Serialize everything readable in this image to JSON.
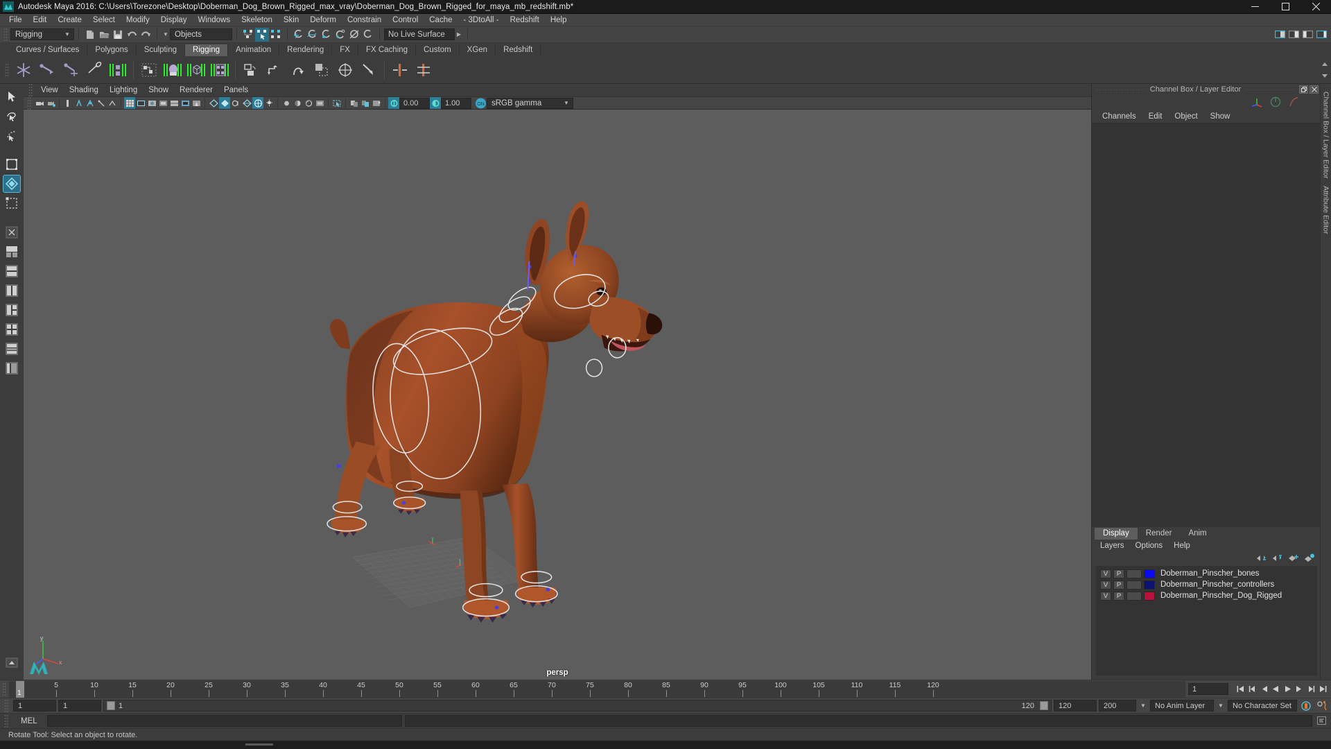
{
  "window": {
    "title": "Autodesk Maya 2016: C:\\Users\\Torezone\\Desktop\\Doberman_Dog_Brown_Rigged_max_vray\\Doberman_Dog_Brown_Rigged_for_maya_mb_redshift.mb*",
    "minimize": "minimize-icon",
    "maximize": "maximize-icon",
    "close": "close-icon"
  },
  "menubar": {
    "items": [
      "File",
      "Edit",
      "Create",
      "Select",
      "Modify",
      "Display",
      "Windows",
      "Skeleton",
      "Skin",
      "Deform",
      "Constrain",
      "Control",
      "Cache",
      "- 3DtoAll -",
      "Redshift",
      "Help"
    ]
  },
  "statusline": {
    "menuset": "Rigging",
    "selection_mask": "Objects",
    "live_surface": "No Live Surface",
    "icons": [
      "new-scene-icon",
      "open-scene-icon",
      "save-scene-icon",
      "undo-icon",
      "redo-icon",
      "select-hierarchy-icon",
      "select-object-icon",
      "select-component-icon",
      "snap-grid-icon",
      "snap-curve-icon",
      "snap-point-icon",
      "snap-projected-icon",
      "snap-view-plane-icon",
      "make-live-icon",
      "show-hide-editors-icon",
      "attribute-editor-icon",
      "tool-settings-icon",
      "channel-box-icon"
    ]
  },
  "shelf": {
    "tabs": [
      "Curves / Surfaces",
      "Polygons",
      "Sculpting",
      "Rigging",
      "Animation",
      "Rendering",
      "FX",
      "FX Caching",
      "Custom",
      "XGen",
      "Redshift"
    ],
    "active_tab": "Rigging",
    "icons": [
      "create-joint-icon",
      "create-ik-handle-icon",
      "create-ik-spline-handle-icon",
      "insert-joint-icon",
      "bind-skin-icon",
      "interactive-bind-icon",
      "paint-skin-weights-icon",
      "smooth-bind-icon",
      "mirror-skin-weights-icon",
      "parent-constraint-icon",
      "point-constraint-icon",
      "orient-constraint-icon",
      "scale-constraint-icon",
      "aim-constraint-icon",
      "pole-vector-constraint-icon",
      "create-deformer-icon",
      "lattice-deformer-icon"
    ]
  },
  "toolbox": {
    "items": [
      "select-tool",
      "lasso-select-tool",
      "paint-select-tool",
      "move-tool",
      "rotate-tool",
      "scale-tool",
      "last-tool",
      "layout-single-icon",
      "layout-two-panes-side-icon",
      "layout-two-panes-stacked-icon",
      "layout-three-panes-icon",
      "layout-four-panes-icon",
      "layout-persp-outliner-icon",
      "layout-hypergraph-icon",
      "layout-more-icon"
    ],
    "selected": "rotate-tool"
  },
  "viewport": {
    "menus": [
      "View",
      "Shading",
      "Lighting",
      "Show",
      "Renderer",
      "Panels"
    ],
    "camera_label": "persp",
    "exposure": "0.00",
    "gamma": "1.00",
    "color_management": "sRGB gamma",
    "color_management_toggle": "ON",
    "toolbar_icons": [
      "select-camera-icon",
      "bookmarks-icon",
      "camera-attributes-icon",
      "image-plane-icon",
      "two-d-pan-zoom-icon",
      "grid-toggle-icon",
      "film-gate-icon",
      "resolution-gate-icon",
      "gate-mask-icon",
      "field-chart-icon",
      "safe-action-icon",
      "safe-title-icon",
      "wireframe-icon",
      "smooth-shade-all-icon",
      "smooth-shade-selected-icon",
      "flat-shade-icon",
      "shaded-wireframe-icon",
      "textured-icon",
      "use-default-lighting-icon",
      "use-all-lights-icon",
      "shadows-icon",
      "ao-icon",
      "motion-blur-icon",
      "multisample-icon",
      "isolate-select-icon",
      "xray-icon",
      "xray-joints-icon",
      "xray-active-components-icon",
      "exposure-icon",
      "gamma-icon"
    ]
  },
  "rightpanel": {
    "title": "Channel Box / Layer Editor",
    "float_btn": "float-panel-icon",
    "close_btn": "close-panel-icon",
    "channel_menus": [
      "Channels",
      "Edit",
      "Object",
      "Show"
    ],
    "vertical_tabs": [
      "Channel Box / Layer Editor",
      "Attribute Editor"
    ],
    "layer_editor": {
      "tabs": [
        "Display",
        "Render",
        "Anim"
      ],
      "active_tab": "Display",
      "menus": [
        "Layers",
        "Options",
        "Help"
      ],
      "toolbar_icons": [
        "move-layer-up-icon",
        "move-layer-down-icon",
        "new-layer-icon",
        "new-layer-from-selected-icon"
      ],
      "columns": [
        "visibility",
        "playback",
        "reserved",
        "color",
        "name"
      ],
      "rows": [
        {
          "v": "V",
          "p": "P",
          "color": "#0a0af0",
          "name": "Doberman_Pinscher_bones"
        },
        {
          "v": "V",
          "p": "P",
          "color": "#0b1270",
          "name": "Doberman_Pinscher_controllers"
        },
        {
          "v": "V",
          "p": "P",
          "color": "#b6123c",
          "name": "Doberman_Pinscher_Dog_Rigged"
        }
      ]
    }
  },
  "timeline": {
    "ticks": [
      5,
      10,
      15,
      20,
      25,
      30,
      35,
      40,
      45,
      50,
      55,
      60,
      65,
      70,
      75,
      80,
      85,
      90,
      95,
      100,
      105,
      110,
      115,
      120
    ],
    "current_frame": "1",
    "frame_field": "1",
    "transport_icons": [
      "go-to-start-icon",
      "step-back-key-icon",
      "step-back-frame-icon",
      "play-backwards-icon",
      "play-forwards-icon",
      "step-forward-frame-icon",
      "step-forward-key-icon",
      "go-to-end-icon"
    ]
  },
  "rangebar": {
    "range_start": "1",
    "anim_start": "1",
    "slider_value": "1",
    "slider_end": "120",
    "range_end": "120",
    "anim_end": "200",
    "anim_layer": "No Anim Layer",
    "character_set": "No Character Set",
    "auto_key_icon": "auto-keyframe-icon",
    "anim_prefs_icon": "animation-preferences-icon"
  },
  "command_line": {
    "label": "MEL",
    "input_value": "",
    "output_value": "",
    "script_editor_icon": "script-editor-icon"
  },
  "helpline": {
    "text": "Rotate Tool: Select an object to rotate."
  },
  "colors": {
    "accent_blue": "#2c6f88",
    "panel_bg": "#3c3c3c",
    "viewport_bg": "#5d5d5d",
    "shelf_icon": "#a79cc8",
    "green_bracket": "#2aef2a"
  }
}
